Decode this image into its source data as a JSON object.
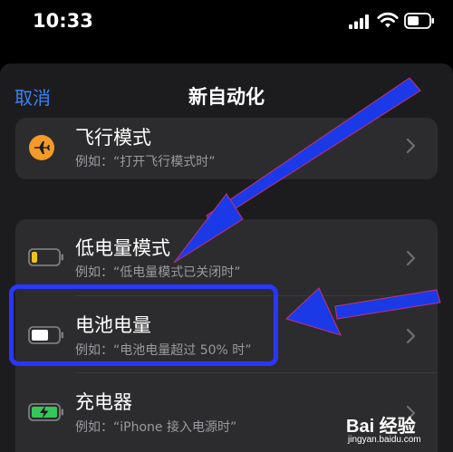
{
  "status_bar": {
    "time": "10:33"
  },
  "nav": {
    "cancel_label": "取消",
    "title": "新自动化"
  },
  "groups": [
    {
      "items": [
        {
          "title": "飞行模式",
          "subtitle": "例如：“打开飞行模式时”",
          "icon": "airplane-icon"
        }
      ]
    },
    {
      "items": [
        {
          "title": "低电量模式",
          "subtitle": "例如：“低电量模式已关闭时”",
          "icon": "low-battery-icon"
        },
        {
          "title": "电池电量",
          "subtitle": "例如：“电池电量超过 50% 时”",
          "icon": "battery-icon"
        },
        {
          "title": "充电器",
          "subtitle": "例如：“iPhone 接入电源时”",
          "icon": "charging-battery-icon"
        }
      ]
    }
  ],
  "watermark": {
    "brand": "Bai 经验",
    "url": "jingyan.baidu.com"
  },
  "colors": {
    "accent": "#3b82f6",
    "airplane_icon_bg": "#f39a28",
    "low_power_yellow": "#f2c318",
    "charging_green": "#34c759",
    "annotation_blue": "#2a36ff"
  }
}
